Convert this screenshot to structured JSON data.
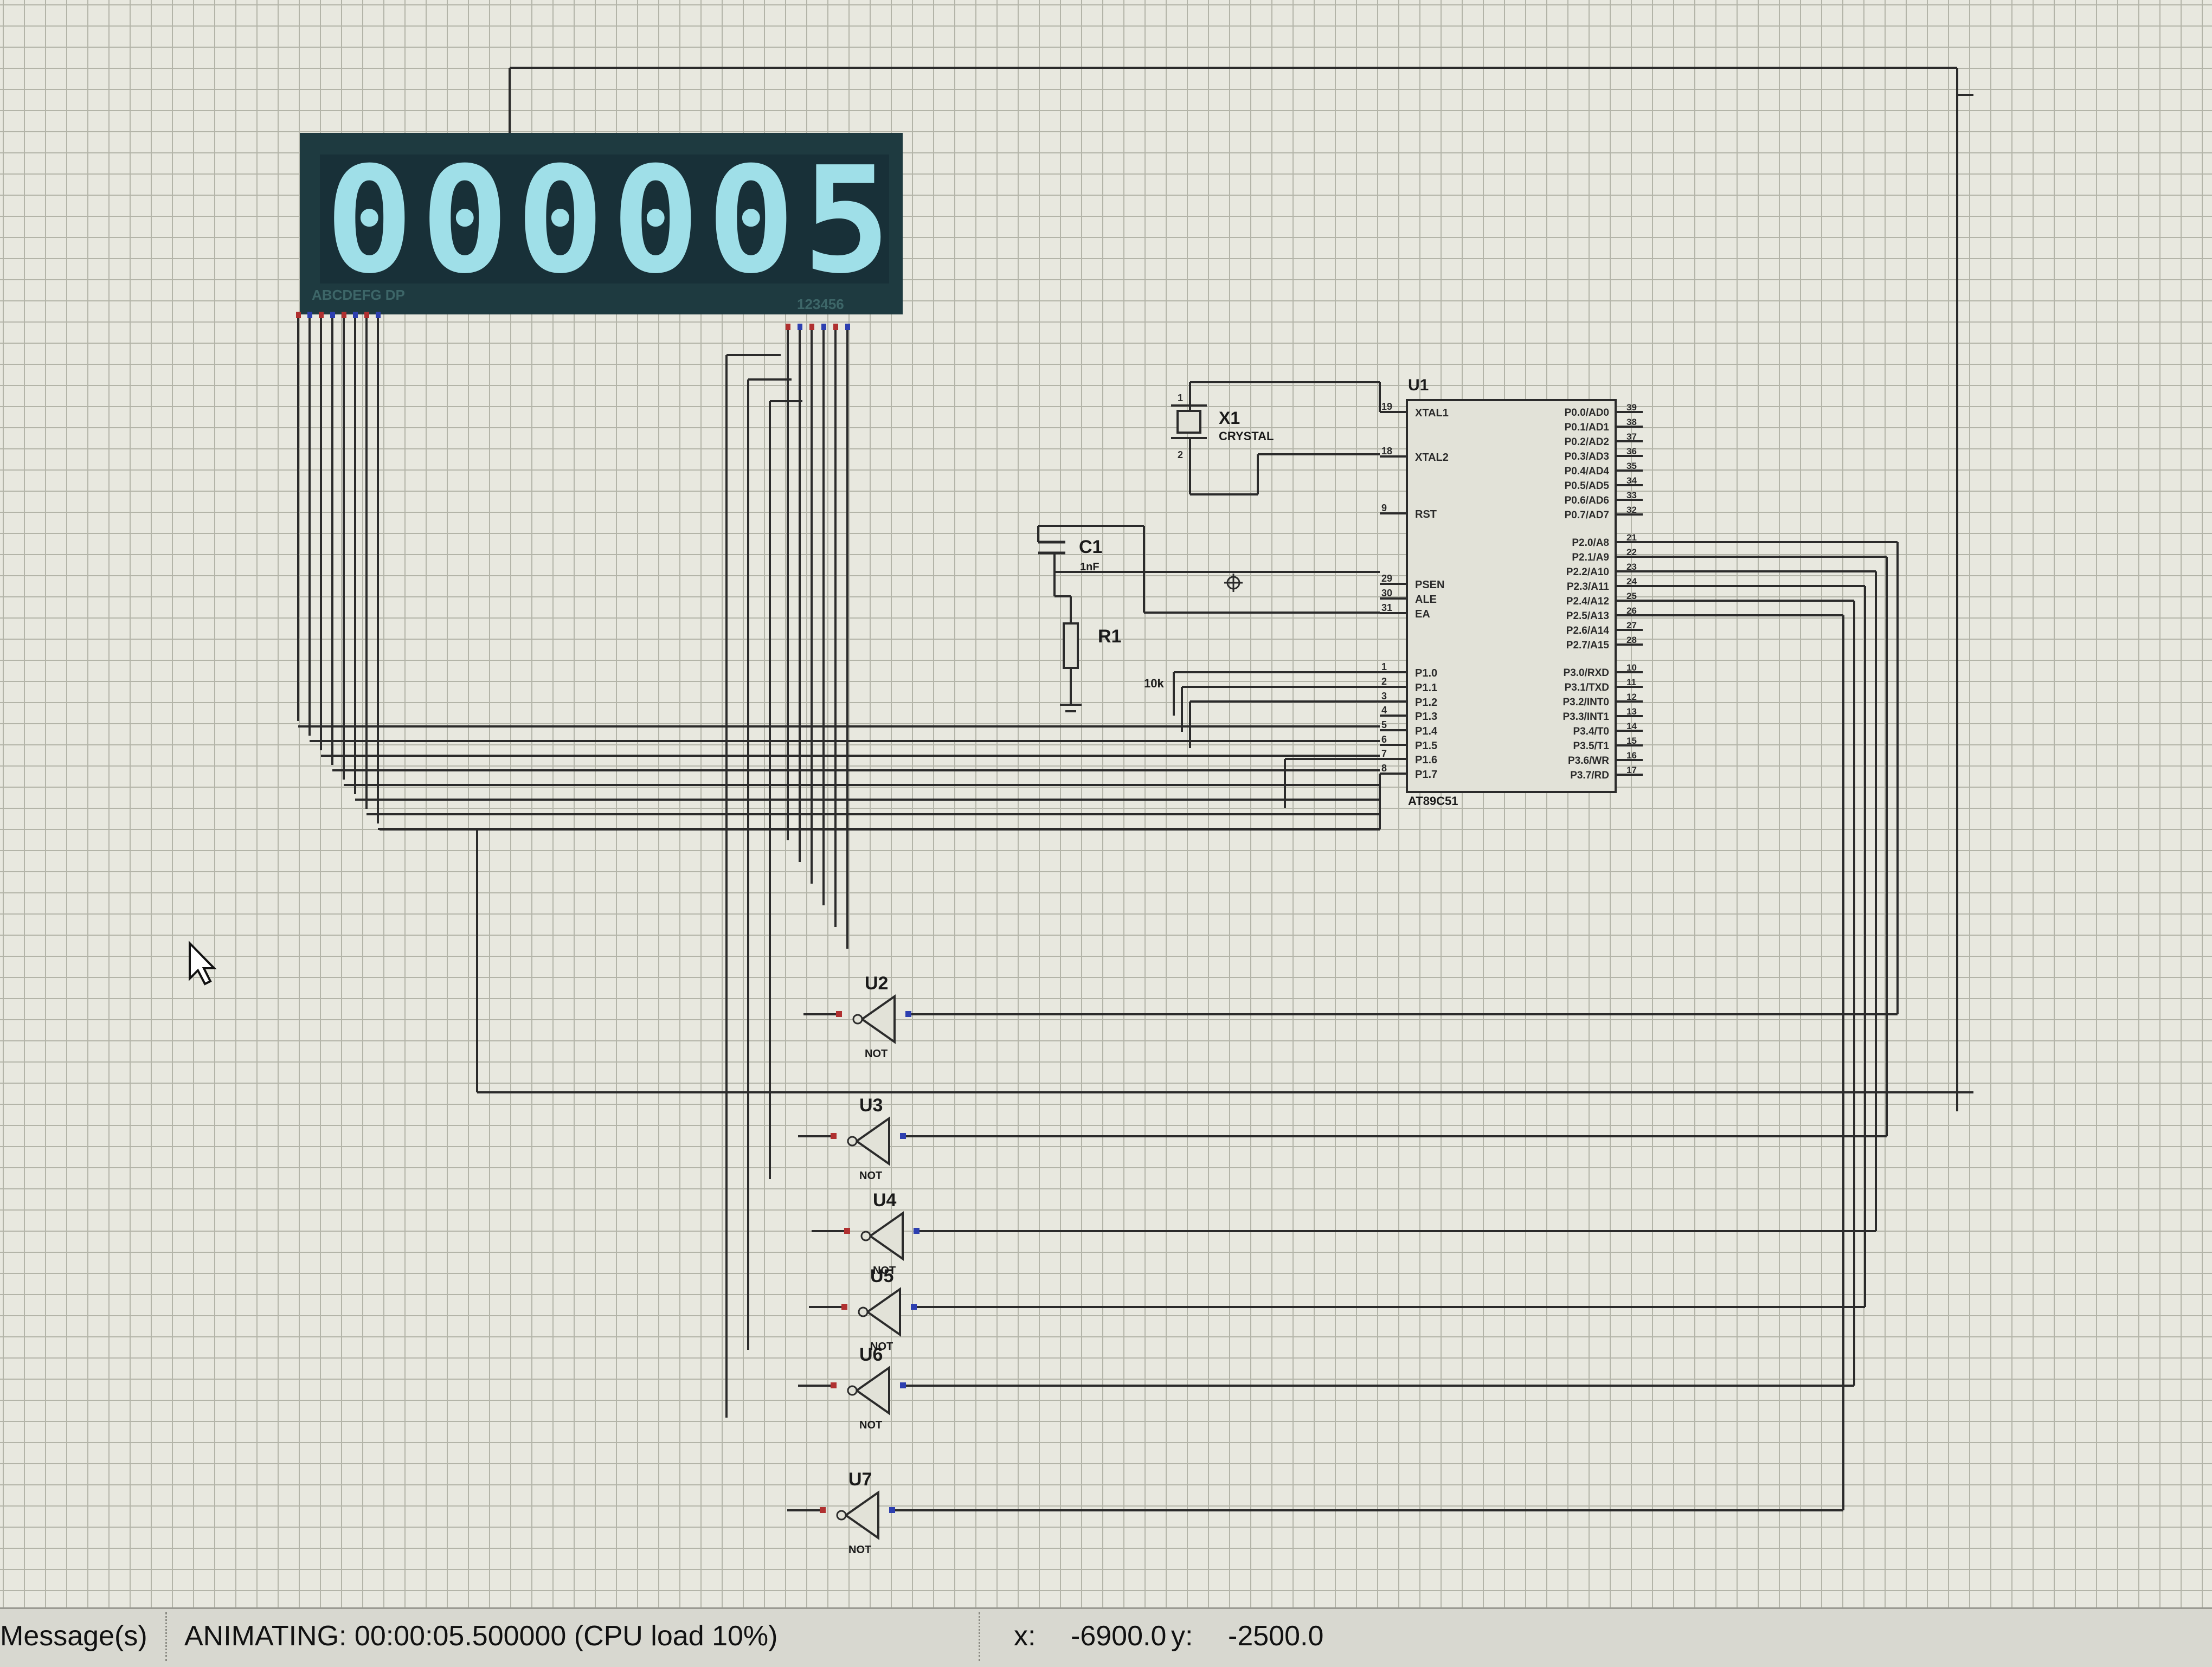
{
  "display": {
    "digits": [
      "0",
      "0",
      "0",
      "0",
      "0",
      "5"
    ],
    "segment_pins_label": "ABCDEFG DP",
    "digit_pins_label": "123456",
    "digit_color": "#9fdfe8",
    "background_color": "#1e3a40"
  },
  "components": {
    "mcu": {
      "ref": "U1",
      "part": "AT89C51",
      "left_pins": [
        {
          "num": "19",
          "name": "XTAL1"
        },
        {
          "num": "18",
          "name": "XTAL2"
        },
        {
          "num": "9",
          "name": "RST"
        },
        {
          "num": "29",
          "name": "PSEN"
        },
        {
          "num": "30",
          "name": "ALE"
        },
        {
          "num": "31",
          "name": "EA"
        },
        {
          "num": "1",
          "name": "P1.0"
        },
        {
          "num": "2",
          "name": "P1.1"
        },
        {
          "num": "3",
          "name": "P1.2"
        },
        {
          "num": "4",
          "name": "P1.3"
        },
        {
          "num": "5",
          "name": "P1.4"
        },
        {
          "num": "6",
          "name": "P1.5"
        },
        {
          "num": "7",
          "name": "P1.6"
        },
        {
          "num": "8",
          "name": "P1.7"
        }
      ],
      "right_pins": [
        {
          "num": "39",
          "name": "P0.0/AD0"
        },
        {
          "num": "38",
          "name": "P0.1/AD1"
        },
        {
          "num": "37",
          "name": "P0.2/AD2"
        },
        {
          "num": "36",
          "name": "P0.3/AD3"
        },
        {
          "num": "35",
          "name": "P0.4/AD4"
        },
        {
          "num": "34",
          "name": "P0.5/AD5"
        },
        {
          "num": "33",
          "name": "P0.6/AD6"
        },
        {
          "num": "32",
          "name": "P0.7/AD7"
        },
        {
          "num": "21",
          "name": "P2.0/A8"
        },
        {
          "num": "22",
          "name": "P2.1/A9"
        },
        {
          "num": "23",
          "name": "P2.2/A10"
        },
        {
          "num": "24",
          "name": "P2.3/A11"
        },
        {
          "num": "25",
          "name": "P2.4/A12"
        },
        {
          "num": "26",
          "name": "P2.5/A13"
        },
        {
          "num": "27",
          "name": "P2.6/A14"
        },
        {
          "num": "28",
          "name": "P2.7/A15"
        },
        {
          "num": "10",
          "name": "P3.0/RXD"
        },
        {
          "num": "11",
          "name": "P3.1/TXD"
        },
        {
          "num": "12",
          "name": "P3.2/INT0"
        },
        {
          "num": "13",
          "name": "P3.3/INT1"
        },
        {
          "num": "14",
          "name": "P3.4/T0"
        },
        {
          "num": "15",
          "name": "P3.5/T1"
        },
        {
          "num": "16",
          "name": "P3.6/WR"
        },
        {
          "num": "17",
          "name": "P3.7/RD"
        }
      ]
    },
    "crystal": {
      "ref": "X1",
      "value": "CRYSTAL",
      "pin1": "1",
      "pin2": "2"
    },
    "capacitor": {
      "ref": "C1",
      "value": "1nF"
    },
    "resistor": {
      "ref": "R1",
      "value": "10k"
    },
    "gates": [
      {
        "ref": "U2",
        "type": "NOT"
      },
      {
        "ref": "U3",
        "type": "NOT"
      },
      {
        "ref": "U4",
        "type": "NOT"
      },
      {
        "ref": "U5",
        "type": "NOT"
      },
      {
        "ref": "U6",
        "type": "NOT"
      },
      {
        "ref": "U7",
        "type": "NOT"
      }
    ]
  },
  "status": {
    "message_label": "Message(s)",
    "animation": "ANIMATING: 00:00:05.500000 (CPU load 10%)",
    "x_label": "x:",
    "x_value": "-6900.0",
    "y_label": "y:",
    "y_value": "-2500.0"
  },
  "colors": {
    "wire": "#2b2b2b",
    "component_body": "#e2e2d8",
    "pin_red": "#b03030",
    "pin_blue": "#2d3fb0"
  }
}
